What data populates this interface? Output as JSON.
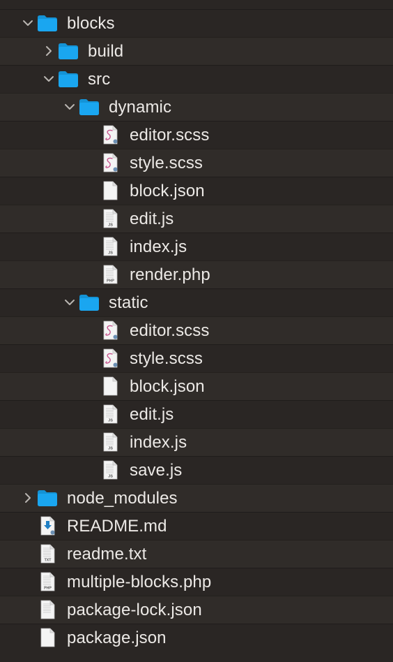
{
  "tree": [
    {
      "label": "blocks",
      "kind": "folder",
      "depth": 0,
      "expanded": true
    },
    {
      "label": "build",
      "kind": "folder",
      "depth": 1,
      "expanded": false
    },
    {
      "label": "src",
      "kind": "folder",
      "depth": 1,
      "expanded": true
    },
    {
      "label": "dynamic",
      "kind": "folder",
      "depth": 2,
      "expanded": true
    },
    {
      "label": "editor.scss",
      "kind": "scss",
      "depth": 3
    },
    {
      "label": "style.scss",
      "kind": "scss",
      "depth": 3
    },
    {
      "label": "block.json",
      "kind": "json",
      "depth": 3
    },
    {
      "label": "edit.js",
      "kind": "js",
      "depth": 3,
      "badge": "JS"
    },
    {
      "label": "index.js",
      "kind": "js",
      "depth": 3,
      "badge": "JS"
    },
    {
      "label": "render.php",
      "kind": "php",
      "depth": 3,
      "badge": "PHP"
    },
    {
      "label": "static",
      "kind": "folder",
      "depth": 2,
      "expanded": true
    },
    {
      "label": "editor.scss",
      "kind": "scss",
      "depth": 3
    },
    {
      "label": "style.scss",
      "kind": "scss",
      "depth": 3
    },
    {
      "label": "block.json",
      "kind": "json",
      "depth": 3
    },
    {
      "label": "edit.js",
      "kind": "js",
      "depth": 3,
      "badge": "JS"
    },
    {
      "label": "index.js",
      "kind": "js",
      "depth": 3,
      "badge": "JS"
    },
    {
      "label": "save.js",
      "kind": "js",
      "depth": 3,
      "badge": "JS"
    },
    {
      "label": "node_modules",
      "kind": "folder",
      "depth": 0,
      "expanded": false
    },
    {
      "label": "README.md",
      "kind": "md",
      "depth": 0
    },
    {
      "label": "readme.txt",
      "kind": "txt",
      "depth": 0,
      "badge": "TXT"
    },
    {
      "label": "multiple-blocks.php",
      "kind": "php",
      "depth": 0,
      "badge": "PHP"
    },
    {
      "label": "package-lock.json",
      "kind": "json-lines",
      "depth": 0
    },
    {
      "label": "package.json",
      "kind": "json",
      "depth": 0
    }
  ],
  "colors": {
    "background": "#2a2624",
    "row_alt": "#302c29",
    "text": "#ece9e6",
    "folder": "#1aa6f0",
    "folder_tab": "#1493d6",
    "chevron": "#b9b5b1",
    "scss_glyph": "#c6538c",
    "md_arrow": "#1f7fc4"
  }
}
